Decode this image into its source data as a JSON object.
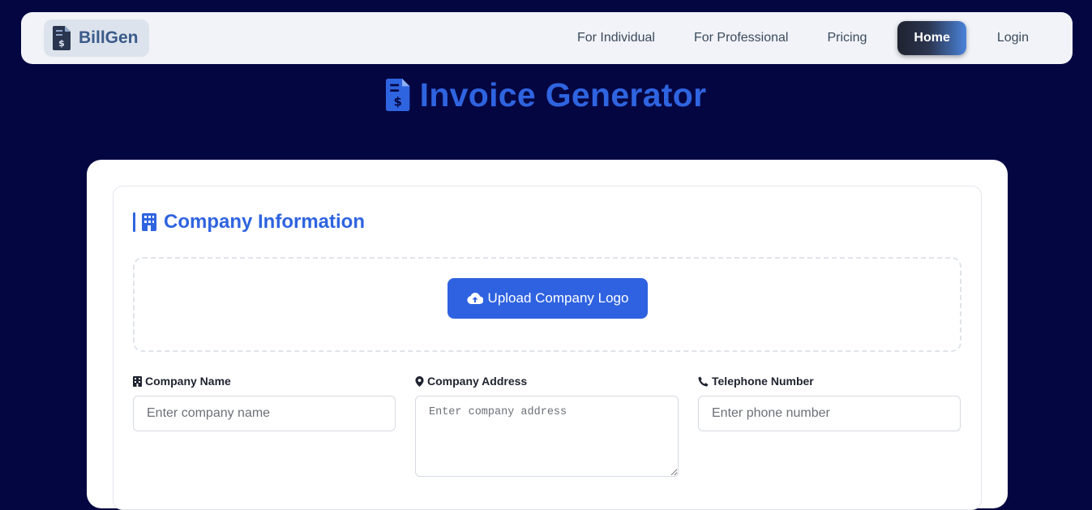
{
  "brand": {
    "name": "BillGen",
    "icon": "invoice-dollar-icon"
  },
  "nav": {
    "items": [
      {
        "label": "For Individual",
        "active": false
      },
      {
        "label": "For Professional",
        "active": false
      },
      {
        "label": "Pricing",
        "active": false
      },
      {
        "label": "Home",
        "active": true
      },
      {
        "label": "Login",
        "active": false
      }
    ]
  },
  "hero": {
    "title": "Invoice Generator",
    "icon": "invoice-dollar-icon"
  },
  "company_section": {
    "title": "Company Information",
    "icon": "building-icon",
    "upload_button": "Upload Company Logo",
    "upload_icon": "cloud-upload-icon",
    "fields": {
      "name": {
        "label": "Company Name",
        "placeholder": "Enter company name",
        "icon": "building-icon"
      },
      "address": {
        "label": "Company Address",
        "placeholder": "Enter company address",
        "icon": "map-marker-icon"
      },
      "phone": {
        "label": "Telephone Number",
        "placeholder": "Enter phone number",
        "icon": "phone-icon"
      }
    }
  },
  "colors": {
    "page_bg": "#040642",
    "accent": "#2f64e0",
    "navbar_bg": "#f1f3f8"
  }
}
